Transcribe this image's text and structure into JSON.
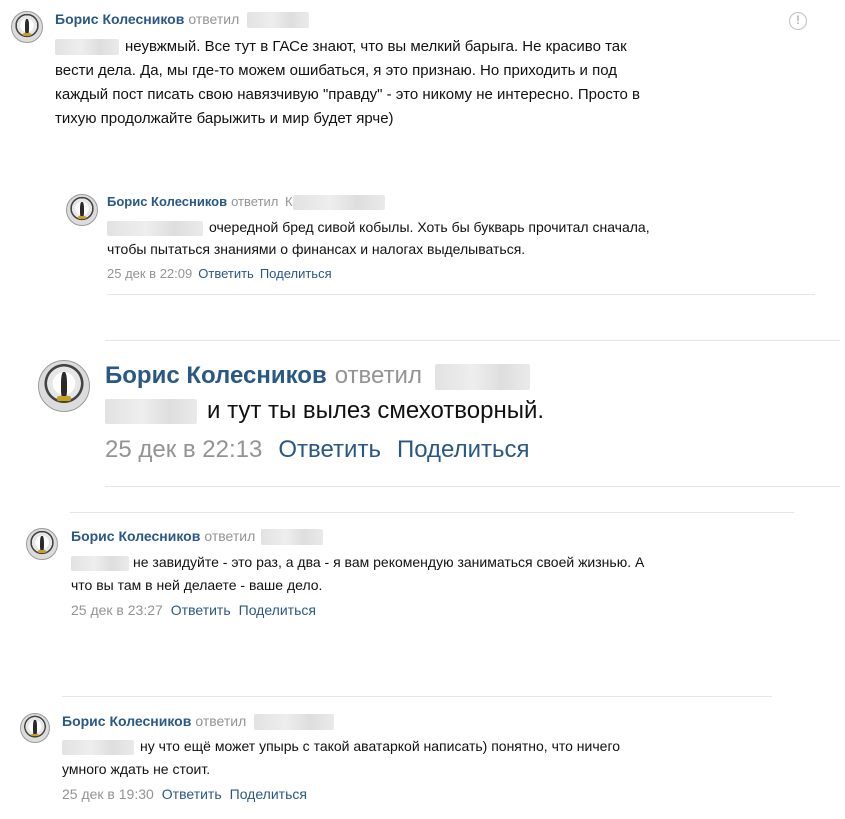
{
  "colors": {
    "author": "#2a5885",
    "link": "#2a5885",
    "meta": "#939393",
    "text": "#111111"
  },
  "icons": {
    "report": "exclamation-circle-icon",
    "avatar": "candle-avatar"
  },
  "comments": [
    {
      "author": "Борис Колесников",
      "replied": "ответил",
      "lines": [
        "неувжмый. Все тут в ГАСе знают, что вы мелкий барыга. Не красиво так",
        "вести дела. Да, мы где-то можем ошибаться, я это признаю. Но приходить и под",
        "каждый пост писать свою навязчивую \"правду\" - это никому не интересно. Просто в",
        "тихую продолжайте барыжить и мир будет ярче)"
      ],
      "report_symbol": "!"
    },
    {
      "author": "Борис Колесников",
      "replied": "ответил",
      "replied_initial": "К",
      "lines": [
        "очередной бред сивой кобылы. Хоть бы букварь прочитал сначала,",
        "чтобы пытаться знаниями о финансах и налогах выделываться."
      ],
      "date": "25 дек в 22:09",
      "reply": "Ответить",
      "share": "Поделиться"
    },
    {
      "author": "Борис Колесников",
      "replied": "ответил",
      "lines": [
        "и тут ты вылез смехотворный."
      ],
      "date": "25 дек в 22:13",
      "reply": "Ответить",
      "share": "Поделиться"
    },
    {
      "author": "Борис Колесников",
      "replied": "ответил",
      "lines": [
        "не завидуйте - это раз, а два - я вам рекомендую заниматься своей жизнью. А",
        "что вы там в ней делаете - ваше дело."
      ],
      "date": "25 дек в 23:27",
      "reply": "Ответить",
      "share": "Поделиться"
    },
    {
      "author": "Борис Колесников",
      "replied": "ответил",
      "lines": [
        "ну что ещё может упырь с такой аватаркой написать) понятно, что ничего",
        "умного ждать не стоит."
      ],
      "date": "25 дек в 19:30",
      "reply": "Ответить",
      "share": "Поделиться"
    }
  ]
}
